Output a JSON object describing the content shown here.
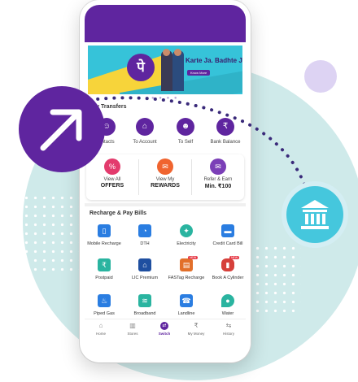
{
  "banner": {
    "logo_glyph": "पे",
    "tagline": "Karte Ja. Badhte Ja.",
    "button_label": "Know More",
    "pager_dots": "● ● ● ●"
  },
  "money_transfers": {
    "title": "ney Transfers",
    "items": [
      {
        "label": "ontacts",
        "icon": "contacts-icon"
      },
      {
        "label": "To Account",
        "icon": "bank-icon"
      },
      {
        "label": "To Self",
        "icon": "self-icon"
      },
      {
        "label": "Bank Balance",
        "icon": "balance-icon"
      }
    ]
  },
  "promos": [
    {
      "line1": "View All",
      "line2": "OFFERS",
      "icon": "percent-icon"
    },
    {
      "line1": "View My",
      "line2": "REWARDS",
      "icon": "gift-icon"
    },
    {
      "line1": "Refer & Earn",
      "line2": "Min. ₹100",
      "icon": "refer-icon"
    }
  ],
  "bills": {
    "title": "Recharge & Pay Bills",
    "items": [
      {
        "label": "Mobile Recharge",
        "icon": "mobile-icon",
        "color": "#2a7de1"
      },
      {
        "label": "DTH",
        "icon": "dish-icon",
        "color": "#2a7de1"
      },
      {
        "label": "Electricity",
        "icon": "bulb-icon",
        "color": "#2ab4a0"
      },
      {
        "label": "Credit Card Bill",
        "icon": "card-icon",
        "color": "#2a7de1"
      },
      {
        "label": "Postpaid",
        "icon": "postpaid-icon",
        "color": "#2ab4a0"
      },
      {
        "label": "LIC Premium",
        "icon": "lic-icon",
        "color": "#1f4fa0"
      },
      {
        "label": "FASTag Recharge",
        "icon": "fastag-icon",
        "color": "#e26f2a",
        "badge": "NEW"
      },
      {
        "label": "Book A Cylinder",
        "icon": "cylinder-icon",
        "color": "#d6403b",
        "badge": "NEW"
      },
      {
        "label": "Piped Gas",
        "icon": "gas-icon",
        "color": "#2a7de1"
      },
      {
        "label": "Broadband",
        "icon": "broadband-icon",
        "color": "#2ab4a0"
      },
      {
        "label": "Landline",
        "icon": "landline-icon",
        "color": "#2a7de1"
      },
      {
        "label": "Water",
        "icon": "water-icon",
        "color": "#2ab4a0"
      }
    ]
  },
  "bottom_nav": [
    {
      "label": "Home",
      "icon": "home-icon"
    },
    {
      "label": "Stores",
      "icon": "store-icon"
    },
    {
      "label": "Switch",
      "icon": "switch-icon"
    },
    {
      "label": "My Money",
      "icon": "money-icon"
    },
    {
      "label": "History",
      "icon": "history-icon"
    }
  ],
  "colors": {
    "brand_purple": "#5f259f",
    "teal": "#45c7dd",
    "background_teal": "#cfeaea"
  }
}
